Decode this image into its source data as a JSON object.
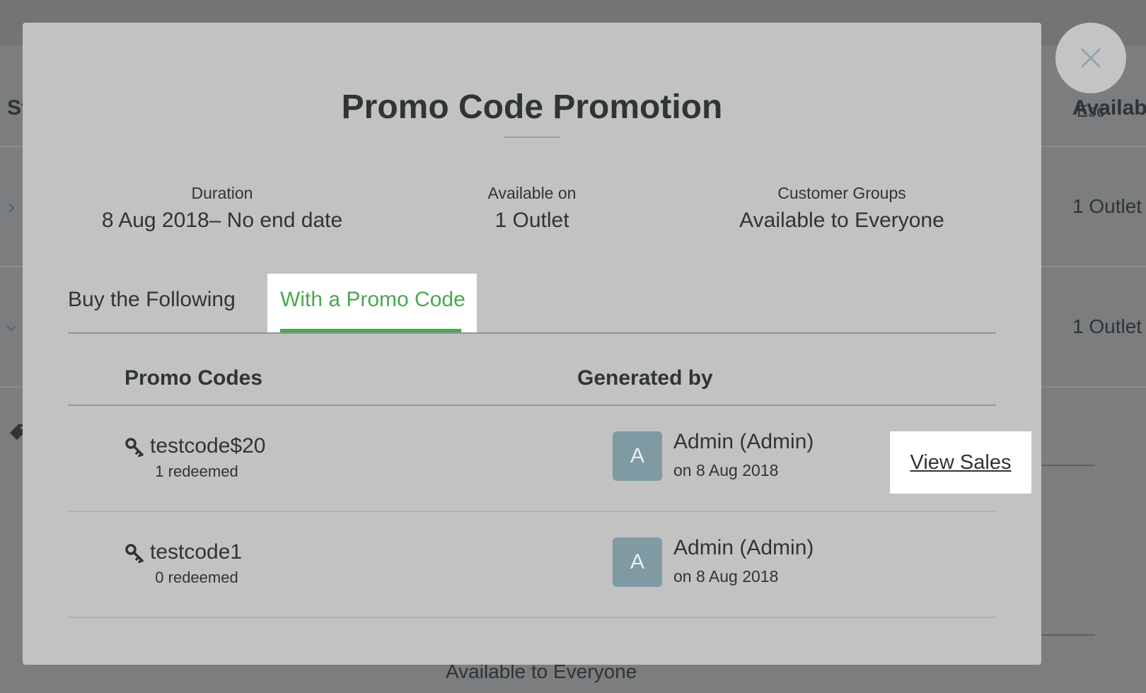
{
  "background": {
    "header_status_fragment": "St",
    "header_available_fragment": "Availabl",
    "rows": [
      {
        "outlets": "1 Outlet"
      },
      {
        "outlets": "1 Outlet"
      }
    ],
    "footer_text": "Available to Everyone"
  },
  "close": {
    "esc_label": "Esc"
  },
  "modal": {
    "title": "Promo Code Promotion",
    "meta": {
      "duration": {
        "label": "Duration",
        "value": "8 Aug 2018– No end date"
      },
      "available_on": {
        "label": "Available on",
        "value": "1 Outlet"
      },
      "customer_groups": {
        "label": "Customer Groups",
        "value": "Available to Everyone"
      }
    },
    "tabs": [
      {
        "label": "Buy the Following",
        "active": false
      },
      {
        "label": "With a Promo Code",
        "active": true
      }
    ],
    "table": {
      "columns": [
        "Promo Codes",
        "Generated by"
      ],
      "rows": [
        {
          "code": "testcode$20",
          "redeemed": "1 redeemed",
          "avatar_letter": "A",
          "generated_by": "Admin (Admin)",
          "generated_on": "on 8 Aug 2018",
          "action_label": "View Sales"
        },
        {
          "code": "testcode1",
          "redeemed": "0 redeemed",
          "avatar_letter": "A",
          "generated_by": "Admin (Admin)",
          "generated_on": "on 8 Aug 2018"
        }
      ]
    }
  },
  "colors": {
    "accent_green": "#4aa84f",
    "avatar_bg": "#7f9aa3",
    "modal_bg": "#c2c2c2",
    "overlay_bg": "#737476"
  },
  "icons": [
    "close-icon",
    "key-icon",
    "chevron-right-icon",
    "chevron-down-icon",
    "tag-icon"
  ]
}
